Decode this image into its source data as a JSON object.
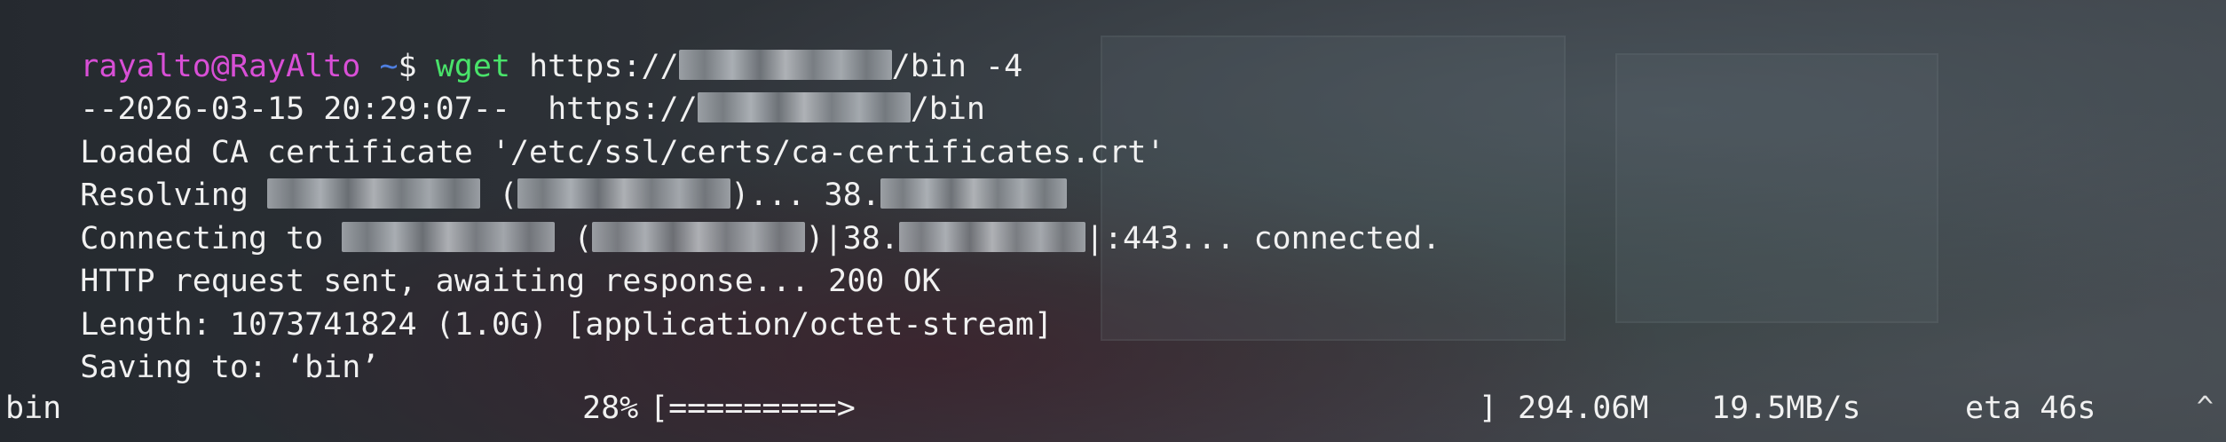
{
  "prompt": {
    "user_host": "rayalto@RayAlto",
    "path": "~",
    "symbol": "$",
    "command": "wget",
    "args_prefix": "https://",
    "args_suffix": "/bin -4"
  },
  "output": {
    "line_timestamp": "--2026-03-15 20:29:07--",
    "line_url_prefix": "https://",
    "line_url_suffix": "/bin",
    "loaded_ca": "Loaded CA certificate '/etc/ssl/certs/ca-certificates.crt'",
    "resolving_label": "Resolving",
    "resolving_open": "(",
    "resolving_close": ")... 38.",
    "connecting_label": "Connecting to",
    "connecting_open": "(",
    "connecting_mid": ")|38.",
    "connecting_end": "|:443... connected.",
    "http_request": "HTTP request sent, awaiting response... 200 OK",
    "length": "Length: 1073741824 (1.0G) [application/octet-stream]",
    "saving": "Saving to: ‘bin’"
  },
  "progress": {
    "filename": "bin",
    "percent": "28%",
    "bar": "[=========>",
    "bar_end": "]",
    "downloaded": "294.06M",
    "speed": "19.5MB/s",
    "eta": "eta 46s",
    "fraction": 0.28
  },
  "colors": {
    "user_host": "#d84fd6",
    "path": "#4f7fe0",
    "command": "#49e36a",
    "text": "#f1f1f1"
  },
  "icons": {
    "scroll_caret": "caret-up-icon"
  },
  "caret_glyph": "^"
}
